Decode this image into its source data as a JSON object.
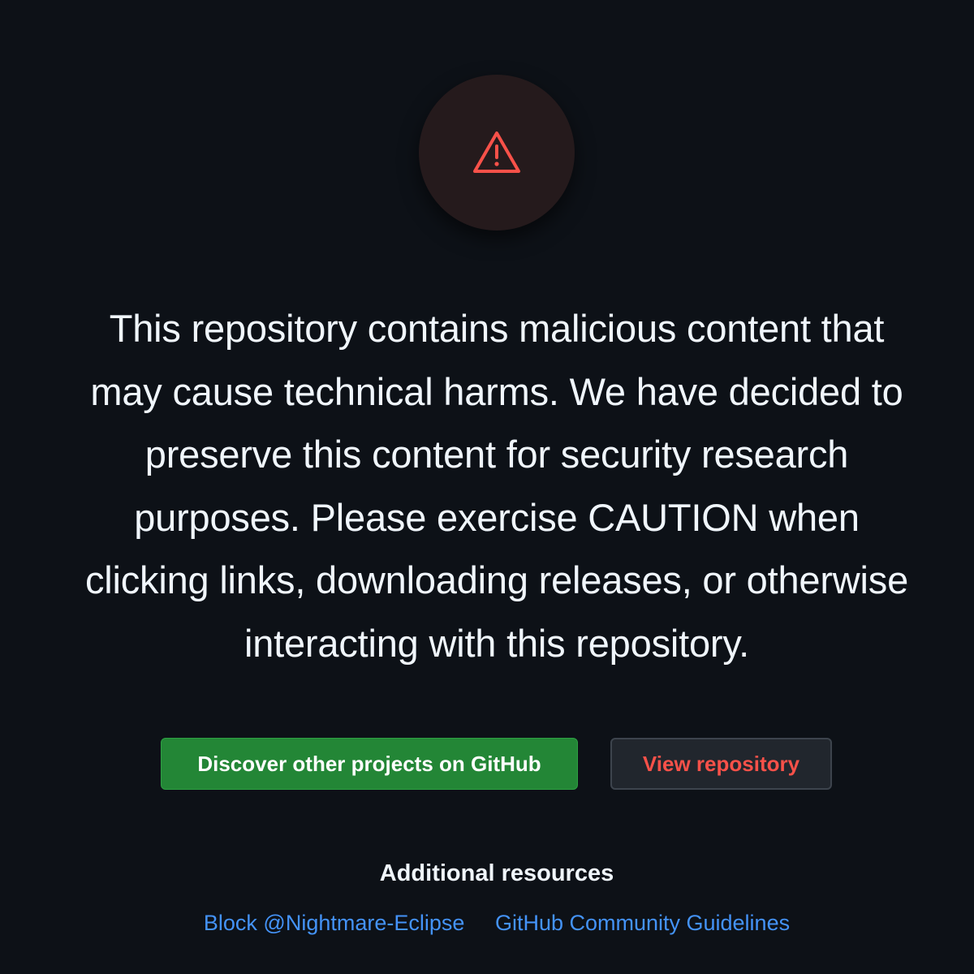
{
  "colors": {
    "background": "#0d1117",
    "warning_circle": "#251a1c",
    "danger": "#f85149",
    "primary_button": "#238636",
    "secondary_button": "#21262d",
    "link": "#4493f8",
    "text": "#f0f6fc"
  },
  "warning": {
    "icon": "alert-triangle-icon"
  },
  "message": "This repository contains malicious content that may cause technical harms. We have decided to preserve this content for security research purposes. Please exercise CAUTION when clicking links, downloading releases, or otherwise interacting with this repository.",
  "actions": {
    "discover_label": "Discover other projects on GitHub",
    "view_label": "View repository"
  },
  "resources": {
    "title": "Additional resources",
    "links": [
      "Block @Nightmare-Eclipse",
      "GitHub Community Guidelines"
    ]
  }
}
